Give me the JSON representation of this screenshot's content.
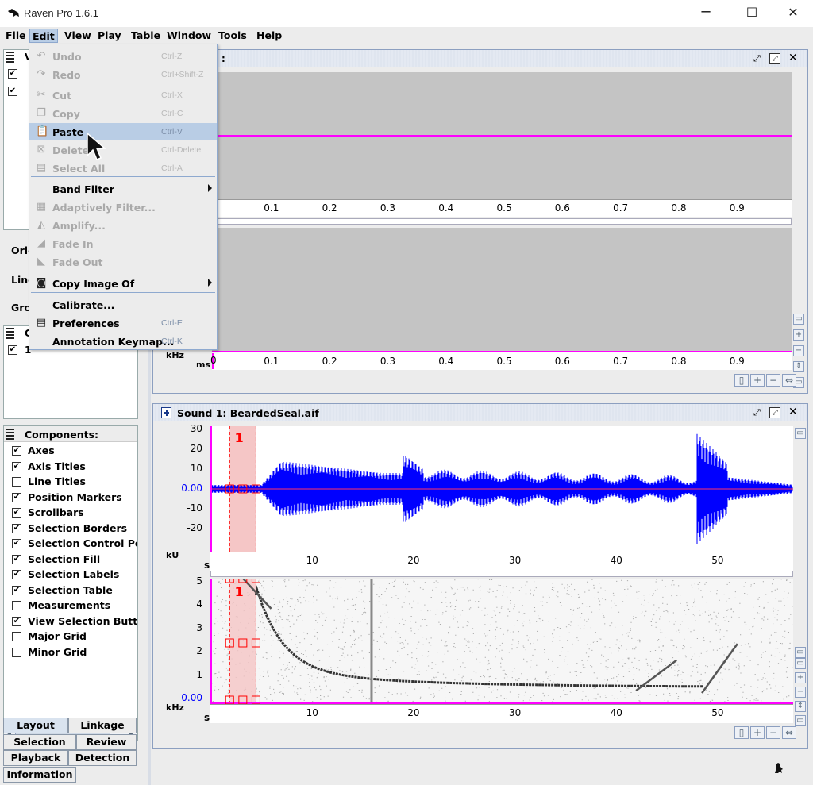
{
  "window": {
    "title": "Raven Pro 1.6.1",
    "minimize": "─",
    "maximize": "☐",
    "close": "✕"
  },
  "menubar": [
    "File",
    "Edit",
    "View",
    "Play",
    "Table",
    "Window",
    "Tools",
    "Help"
  ],
  "edit_menu": {
    "items": [
      {
        "label": "Undo",
        "shortcut": "Ctrl-Z",
        "icon": "undo-icon"
      },
      {
        "label": "Redo",
        "shortcut": "Ctrl+Shift-Z",
        "icon": "redo-icon"
      },
      {
        "label": "Cut",
        "shortcut": "Ctrl-X",
        "icon": "scissors-icon"
      },
      {
        "label": "Copy",
        "shortcut": "Ctrl-C",
        "icon": "copy-icon"
      },
      {
        "label": "Paste",
        "shortcut": "Ctrl-V",
        "icon": "clipboard-icon"
      },
      {
        "label": "Delete",
        "shortcut": "Ctrl-Delete",
        "icon": "delete-icon"
      },
      {
        "label": "Select All",
        "shortcut": "Ctrl-A",
        "icon": "select-all-icon"
      },
      {
        "label": "Band Filter",
        "shortcut": "",
        "icon": ""
      },
      {
        "label": "Adaptively Filter...",
        "shortcut": "",
        "icon": "filter-icon"
      },
      {
        "label": "Amplify...",
        "shortcut": "",
        "icon": "amplify-icon"
      },
      {
        "label": "Fade In",
        "shortcut": "",
        "icon": "fade-in-icon"
      },
      {
        "label": "Fade Out",
        "shortcut": "",
        "icon": "fade-out-icon"
      },
      {
        "label": "Copy Image Of",
        "shortcut": "",
        "icon": "camera-icon"
      },
      {
        "label": "Calibrate...",
        "shortcut": "",
        "icon": ""
      },
      {
        "label": "Preferences",
        "shortcut": "Ctrl-E",
        "icon": "preferences-icon"
      },
      {
        "label": "Annotation Keymap...",
        "shortcut": "Ctrl-K",
        "icon": ""
      }
    ]
  },
  "left_panel": {
    "partial_labels": [
      "V",
      "Orie",
      "Line",
      "Gro",
      "C",
      "1"
    ],
    "components_title": "Components:",
    "components": [
      {
        "label": "Axes",
        "checked": true
      },
      {
        "label": "Axis Titles",
        "checked": true
      },
      {
        "label": "Line Titles",
        "checked": false
      },
      {
        "label": "Position Markers",
        "checked": true
      },
      {
        "label": "Scrollbars",
        "checked": true
      },
      {
        "label": "Selection Borders",
        "checked": true
      },
      {
        "label": "Selection Control Point",
        "checked": true
      },
      {
        "label": "Selection Fill",
        "checked": true
      },
      {
        "label": "Selection Labels",
        "checked": true
      },
      {
        "label": "Selection Table",
        "checked": true
      },
      {
        "label": "Measurements",
        "checked": false
      },
      {
        "label": "View Selection Buttons",
        "checked": true
      },
      {
        "label": "Major Grid",
        "checked": false
      },
      {
        "label": "Minor Grid",
        "checked": false
      }
    ],
    "tabs": [
      "Layout",
      "Linkage",
      "Selection",
      "Review",
      "Playback",
      "Detection",
      "Information"
    ],
    "check_mark": "✔"
  },
  "top_window": {
    "title_fragment": ":",
    "x_ticks": [
      "0.1",
      "0.2",
      "0.3",
      "0.4",
      "0.5",
      "0.6",
      "0.7",
      "0.8",
      "0.9"
    ],
    "x_zero": "0",
    "y_unit": "kHz",
    "x_unit": "ms"
  },
  "sound_window": {
    "title": "Sound 1: BeardedSeal.aif",
    "waveform": {
      "y_ticks": [
        "30",
        "20",
        "10",
        "0.00",
        "-10",
        "-20"
      ],
      "y_unit": "kU",
      "x_unit": "s"
    },
    "spectrogram": {
      "y_ticks": [
        "5",
        "4",
        "3",
        "2",
        "1",
        "0.00"
      ],
      "y_unit": "kHz",
      "x_unit": "s"
    },
    "x_ticks": [
      "10",
      "20",
      "30",
      "40",
      "50"
    ],
    "selection_label": "1"
  },
  "colors": {
    "waveform": "#0000ff",
    "position_marker": "#ff00ff",
    "selection": "#ff0000",
    "menu_highlight": "#b9cde5"
  }
}
